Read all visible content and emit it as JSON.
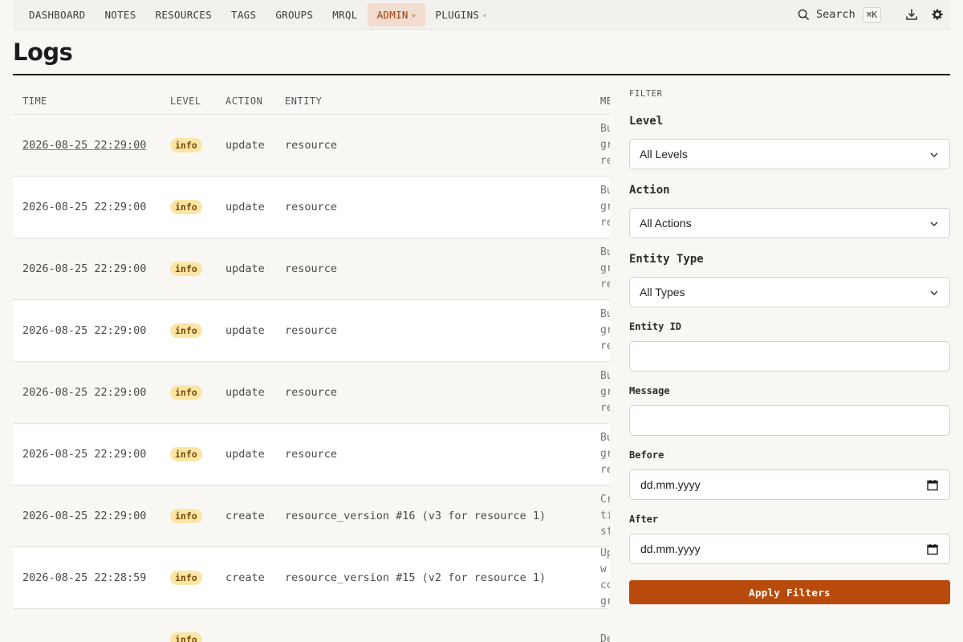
{
  "nav": {
    "items": [
      {
        "label": "DASHBOARD",
        "active": false,
        "dropdown": false
      },
      {
        "label": "NOTES",
        "active": false,
        "dropdown": false
      },
      {
        "label": "RESOURCES",
        "active": false,
        "dropdown": false
      },
      {
        "label": "TAGS",
        "active": false,
        "dropdown": false
      },
      {
        "label": "GROUPS",
        "active": false,
        "dropdown": false
      },
      {
        "label": "MRQL",
        "active": false,
        "dropdown": false
      },
      {
        "label": "ADMIN",
        "active": true,
        "dropdown": true
      },
      {
        "label": "PLUGINS",
        "active": false,
        "dropdown": true
      }
    ],
    "search_label": "Search",
    "search_shortcut": "⌘K",
    "icons": [
      "search-icon",
      "download-icon",
      "gear-icon"
    ]
  },
  "page": {
    "title": "Logs"
  },
  "table": {
    "columns": [
      "TIME",
      "LEVEL",
      "ACTION",
      "ENTITY",
      "ME"
    ],
    "rows": [
      {
        "time": "2026-08-25 22:29:00",
        "level": "info",
        "action": "update",
        "entity": "resource",
        "message": [
          "Bu",
          "gr",
          "re"
        ]
      },
      {
        "time": "2026-08-25 22:29:00",
        "level": "info",
        "action": "update",
        "entity": "resource",
        "message": [
          "Bu",
          "gr",
          "re"
        ]
      },
      {
        "time": "2026-08-25 22:29:00",
        "level": "info",
        "action": "update",
        "entity": "resource",
        "message": [
          "Bu",
          "gr",
          "re"
        ]
      },
      {
        "time": "2026-08-25 22:29:00",
        "level": "info",
        "action": "update",
        "entity": "resource",
        "message": [
          "Bu",
          "gr",
          "re"
        ]
      },
      {
        "time": "2026-08-25 22:29:00",
        "level": "info",
        "action": "update",
        "entity": "resource",
        "message": [
          "Bu",
          "gr",
          "re"
        ]
      },
      {
        "time": "2026-08-25 22:29:00",
        "level": "info",
        "action": "update",
        "entity": "resource",
        "message": [
          "Bu",
          "gr",
          "re"
        ]
      },
      {
        "time": "2026-08-25 22:29:00",
        "level": "info",
        "action": "create",
        "entity": "resource_version #16 (v3 for resource 1)",
        "message": [
          "Cr",
          "tig",
          "st"
        ]
      },
      {
        "time": "2026-08-25 22:28:59",
        "level": "info",
        "action": "create",
        "entity": "resource_version #15 (v2 for resource 1)",
        "message": [
          "Up",
          "w",
          "co",
          "gr"
        ]
      },
      {
        "time": "",
        "level": "info",
        "action": "",
        "entity": "",
        "message": [
          "De"
        ]
      }
    ]
  },
  "filter": {
    "title": "FILTER",
    "level_label": "Level",
    "level_value": "All Levels",
    "action_label": "Action",
    "action_value": "All Actions",
    "entity_type_label": "Entity Type",
    "entity_type_value": "All Types",
    "entity_id_label": "Entity ID",
    "entity_id_value": "",
    "message_label": "Message",
    "message_value": "",
    "before_label": "Before",
    "before_placeholder": "dd.mm.yyyy",
    "after_label": "After",
    "after_placeholder": "dd.mm.yyyy",
    "apply_label": "Apply Filters"
  },
  "colors": {
    "accent": "#b84a0c",
    "active_nav_bg": "#f1dccf",
    "badge_bg": "#fbe6a8"
  }
}
